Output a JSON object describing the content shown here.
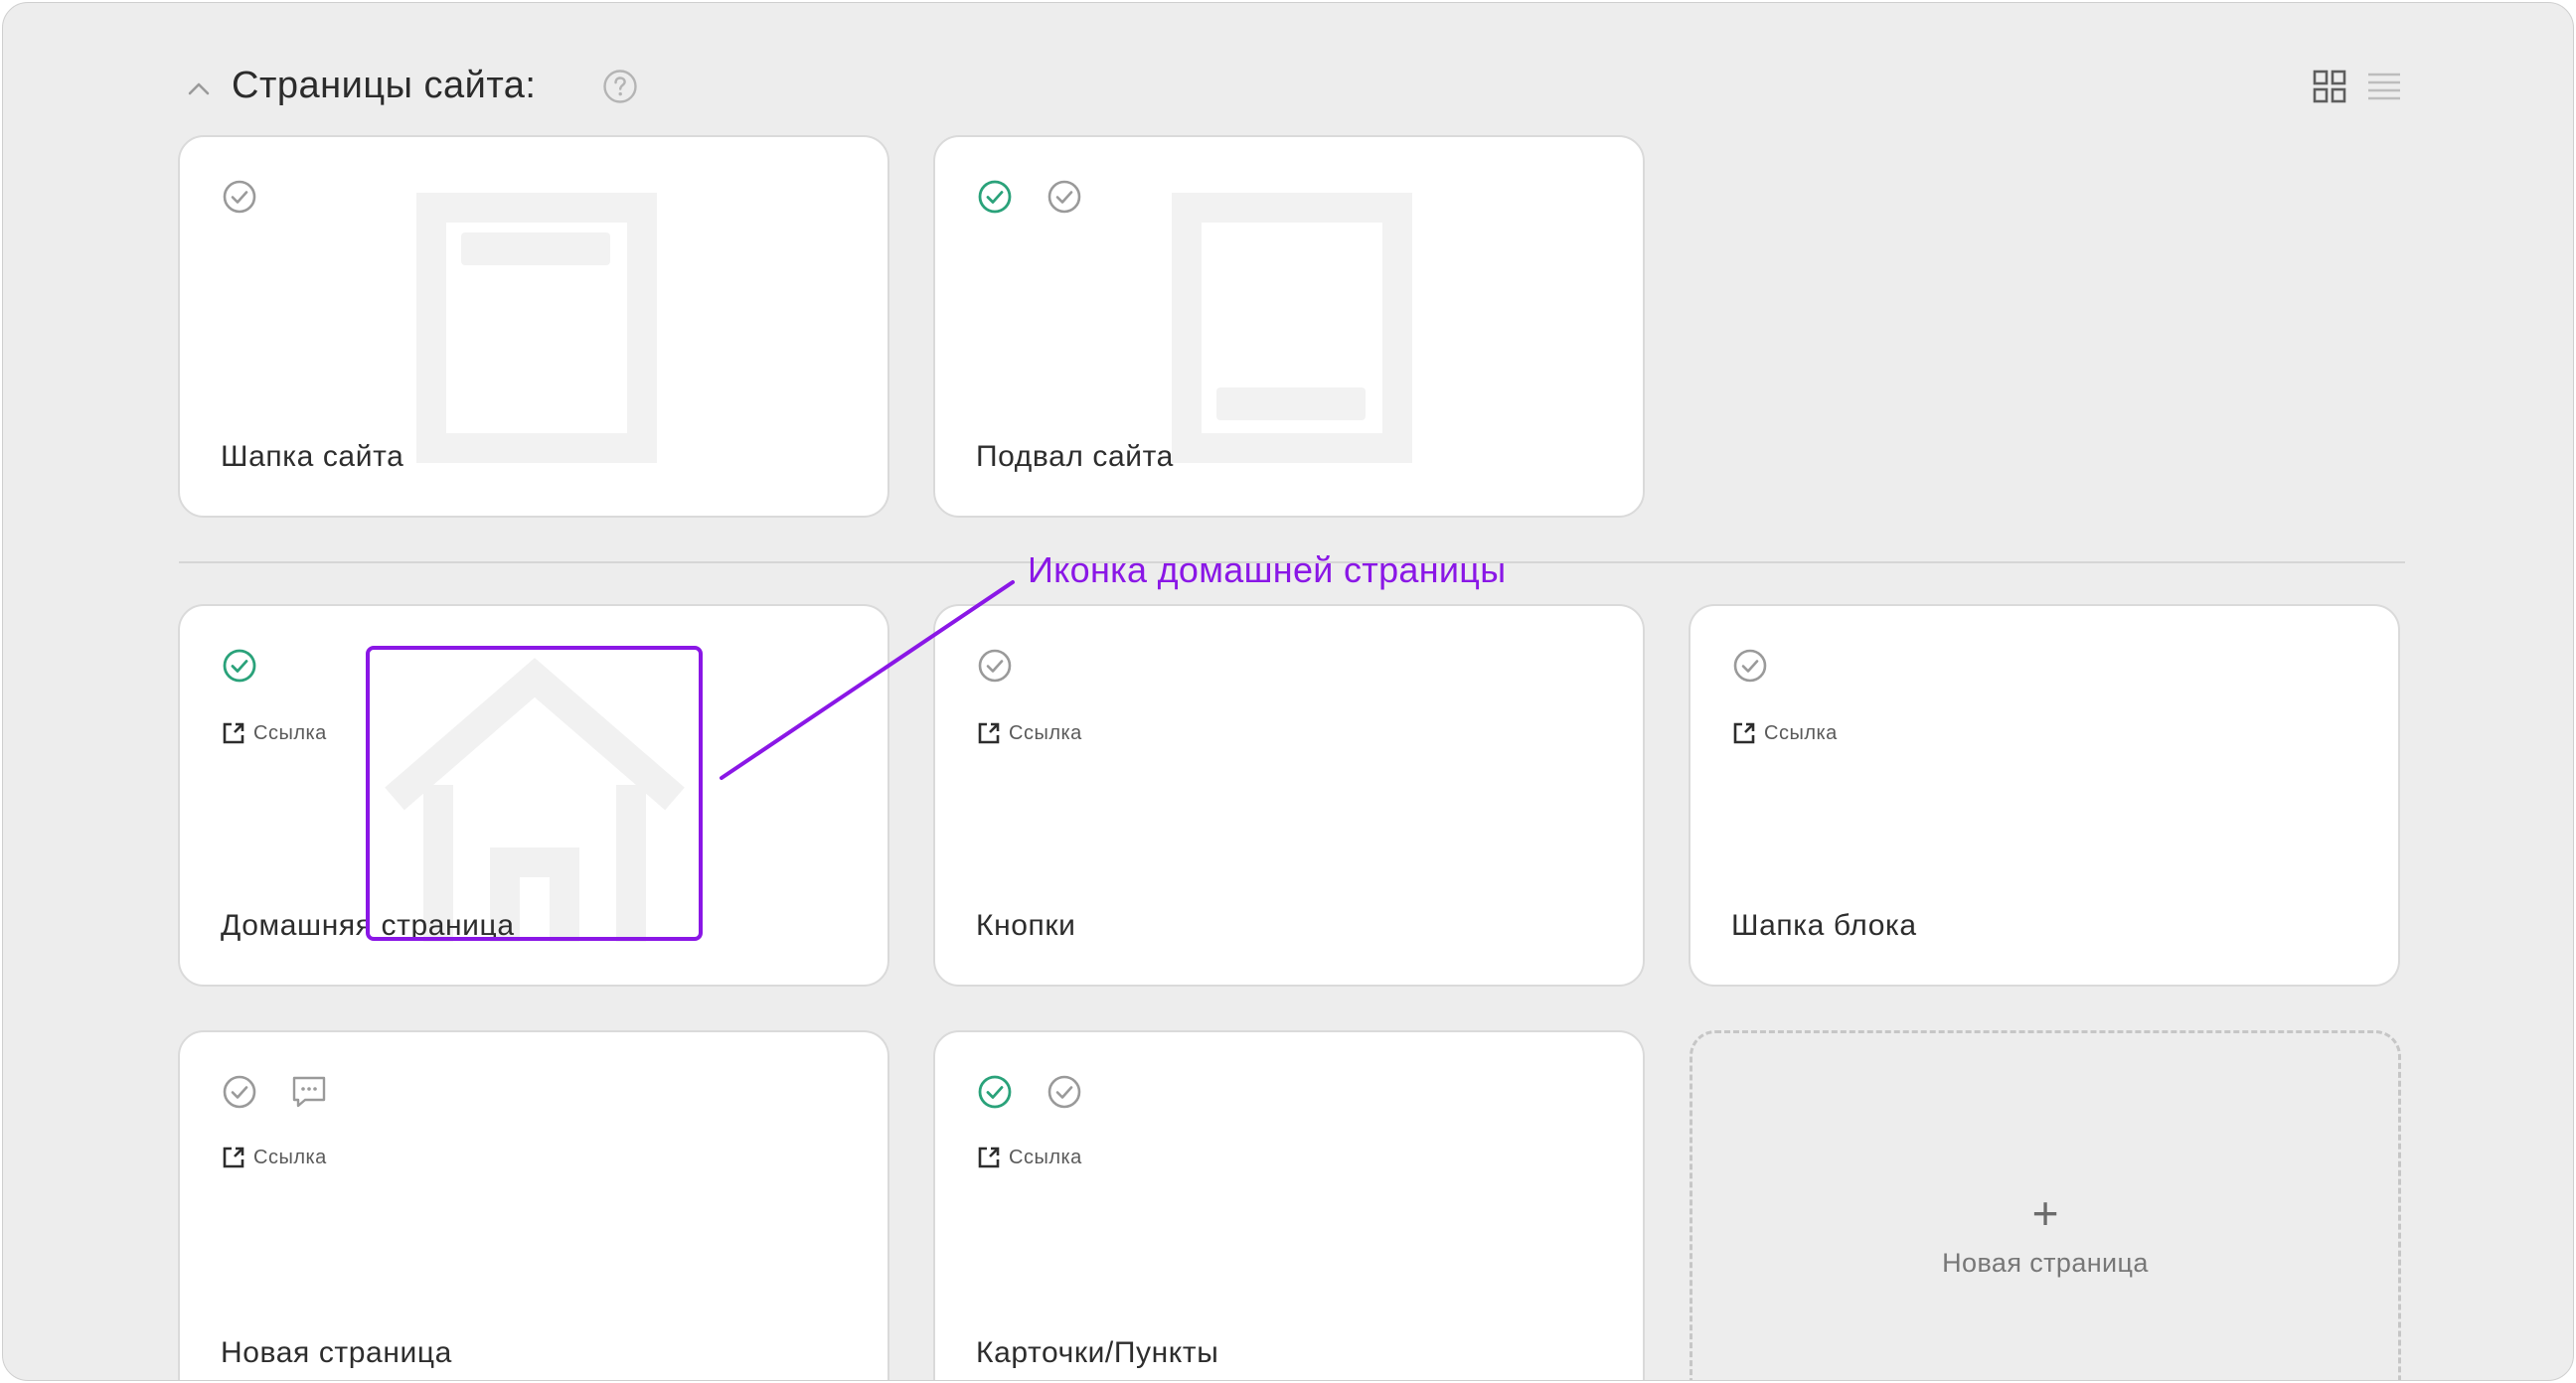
{
  "header": {
    "title": "Страницы сайта:",
    "collapse_icon": "chevron-up-icon",
    "help_icon": "question-circle-icon",
    "view_icons": [
      "grid-view-icon",
      "list-view-icon"
    ]
  },
  "top_cards": [
    {
      "title": "Шапка сайта",
      "thumbnail": "header-thumbnail-icon"
    },
    {
      "title": "Подвал сайта",
      "thumbnail": "footer-thumbnail-icon"
    }
  ],
  "pages": [
    {
      "title": "Домашняя страница",
      "link_label": "Ссылка",
      "thumbnail": "home-icon"
    },
    {
      "title": "Кнопки",
      "link_label": "Ссылка"
    },
    {
      "title": "Шапка блока",
      "link_label": "Ссылка"
    },
    {
      "title": "Новая страница",
      "link_label": "Ссылка",
      "has_comment": true
    },
    {
      "title": "Карточки/Пункты",
      "link_label": "Ссылка"
    }
  ],
  "new_page": {
    "plus": "+",
    "label": "Новая страница"
  },
  "annotation": {
    "text": "Иконка домашней страницы",
    "color": "#8a17e6"
  },
  "colors": {
    "check_active": "#2aa27a",
    "check_inactive": "#9a9a9a",
    "background": "#ededed",
    "card": "#ffffff"
  }
}
